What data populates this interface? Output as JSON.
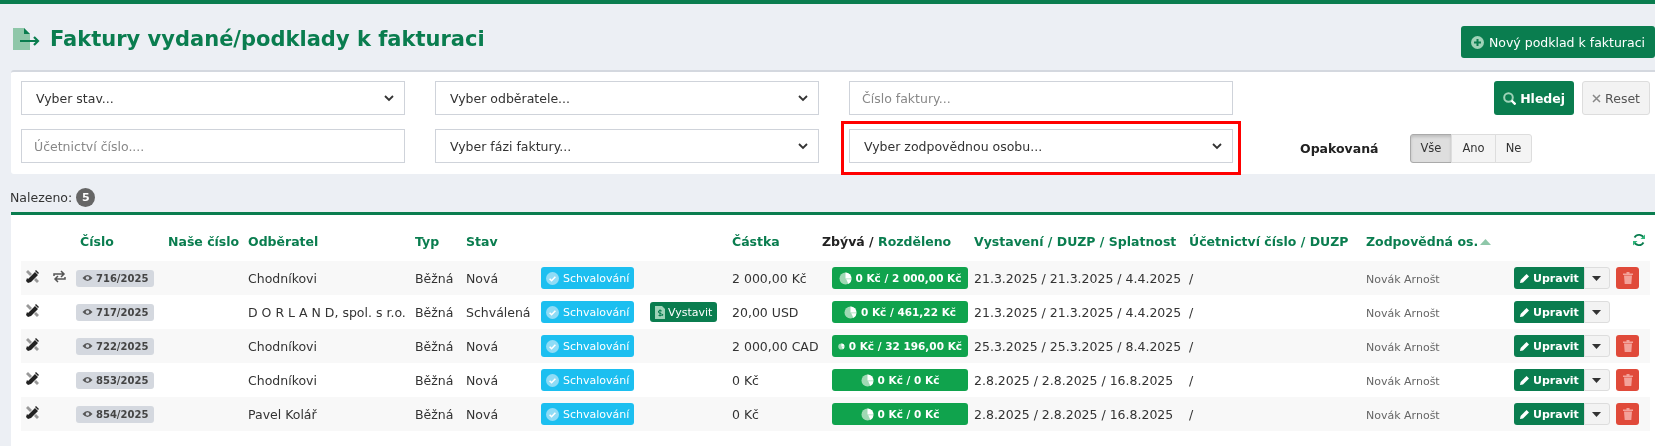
{
  "header": {
    "title": "Faktury vydané/podklady k fakturaci",
    "new_button": "Nový podklad k fakturaci"
  },
  "filters": {
    "fields": [
      {
        "kind": "select",
        "value": "Vyber stav...",
        "highlighted": false
      },
      {
        "kind": "select",
        "value": "Vyber odběratele...",
        "highlighted": false
      },
      {
        "kind": "input",
        "placeholder": "Číslo faktury...",
        "highlighted": false
      },
      {
        "kind": "input",
        "placeholder": "Účetnictví číslo....",
        "highlighted": false
      },
      {
        "kind": "select",
        "value": "Vyber fázi faktury...",
        "highlighted": false
      },
      {
        "kind": "select",
        "value": "Vyber zodpovědnou osobu...",
        "highlighted": true
      }
    ],
    "search_button": "Hledej",
    "reset_button": "Reset",
    "recurring": {
      "label": "Opakovaná",
      "options": [
        {
          "label": "Vše",
          "selected": true
        },
        {
          "label": "Ano",
          "selected": false
        },
        {
          "label": "Ne",
          "selected": false
        }
      ]
    }
  },
  "found": {
    "label": "Nalezeno:",
    "count": "5"
  },
  "table": {
    "columns": [
      {},
      {},
      {
        "parts": [
          {
            "text": "Číslo",
            "dark": false
          }
        ]
      },
      {
        "parts": [
          {
            "text": "Naše číslo",
            "dark": false
          }
        ]
      },
      {
        "parts": [
          {
            "text": "Odběratel",
            "dark": false
          }
        ]
      },
      {
        "parts": [
          {
            "text": "Typ",
            "dark": false
          }
        ]
      },
      {
        "parts": [
          {
            "text": "Stav",
            "dark": false
          }
        ]
      },
      {},
      {},
      {
        "parts": [
          {
            "text": "Částka",
            "dark": false
          }
        ]
      },
      {
        "parts": [
          {
            "text": "Zbývá",
            "dark": true
          },
          {
            "text": " / ",
            "dark": true
          },
          {
            "text": "Rozděleno",
            "dark": false
          }
        ]
      },
      {
        "parts": [
          {
            "text": "Vystavení / DUZP / Splatnost",
            "dark": false
          }
        ]
      },
      {
        "parts": [
          {
            "text": "Účetnictví číslo / DUZP",
            "dark": false
          }
        ]
      },
      {
        "parts": [
          {
            "text": "Zodpovědná os.",
            "dark": false
          }
        ],
        "sort_ascending": true
      },
      {},
      {
        "refresh": true
      }
    ],
    "rows": [
      {
        "recurring": true,
        "number": "716/2025",
        "customer": "Chodníkovi",
        "type": "Běžná",
        "state": "Nová",
        "approval": "Schvalování",
        "amount": "2 000,00 Kč",
        "split": "0 Kč / 2 000,00 Kč",
        "dates": "21.3.2025 / 21.3.2025 / 4.4.2025",
        "accounting": "/",
        "responsible": "Novák Arnošt",
        "edit": "Upravit",
        "deletable": true
      },
      {
        "recurring": false,
        "number": "717/2025",
        "customer": "D O R L A N D, spol. s r.o.",
        "type": "Běžná",
        "state": "Schválená",
        "approval": "Schvalování",
        "issue": "Vystavit",
        "amount": "20,00 USD",
        "split": "0 Kč / 461,22 Kč",
        "dates": "21.3.2025 / 21.3.2025 / 4.4.2025",
        "accounting": "/",
        "responsible": "Novák Arnošt",
        "edit": "Upravit",
        "deletable": false
      },
      {
        "recurring": false,
        "number": "722/2025",
        "customer": "Chodníkovi",
        "type": "Běžná",
        "state": "Nová",
        "approval": "Schvalování",
        "amount": "2 000,00 CAD",
        "split": "0 Kč / 32 196,00 Kč",
        "dates": "25.3.2025 / 25.3.2025 / 8.4.2025",
        "accounting": "/",
        "responsible": "Novák Arnošt",
        "edit": "Upravit",
        "deletable": true
      },
      {
        "recurring": false,
        "number": "853/2025",
        "customer": "Chodníkovi",
        "type": "Běžná",
        "state": "Nová",
        "approval": "Schvalování",
        "amount": "0 Kč",
        "split": "0 Kč / 0 Kč",
        "dates": "2.8.2025 / 2.8.2025 / 16.8.2025",
        "accounting": "/",
        "responsible": "Novák Arnošt",
        "edit": "Upravit",
        "deletable": true
      },
      {
        "recurring": false,
        "number": "854/2025",
        "customer": "Pavel Kolář",
        "type": "Běžná",
        "state": "Nová",
        "approval": "Schvalování",
        "amount": "0 Kč",
        "split": "0 Kč / 0 Kč",
        "dates": "2.8.2025 / 2.8.2025 / 16.8.2025",
        "accounting": "/",
        "responsible": "Novák Arnošt",
        "edit": "Upravit",
        "deletable": true
      }
    ]
  }
}
